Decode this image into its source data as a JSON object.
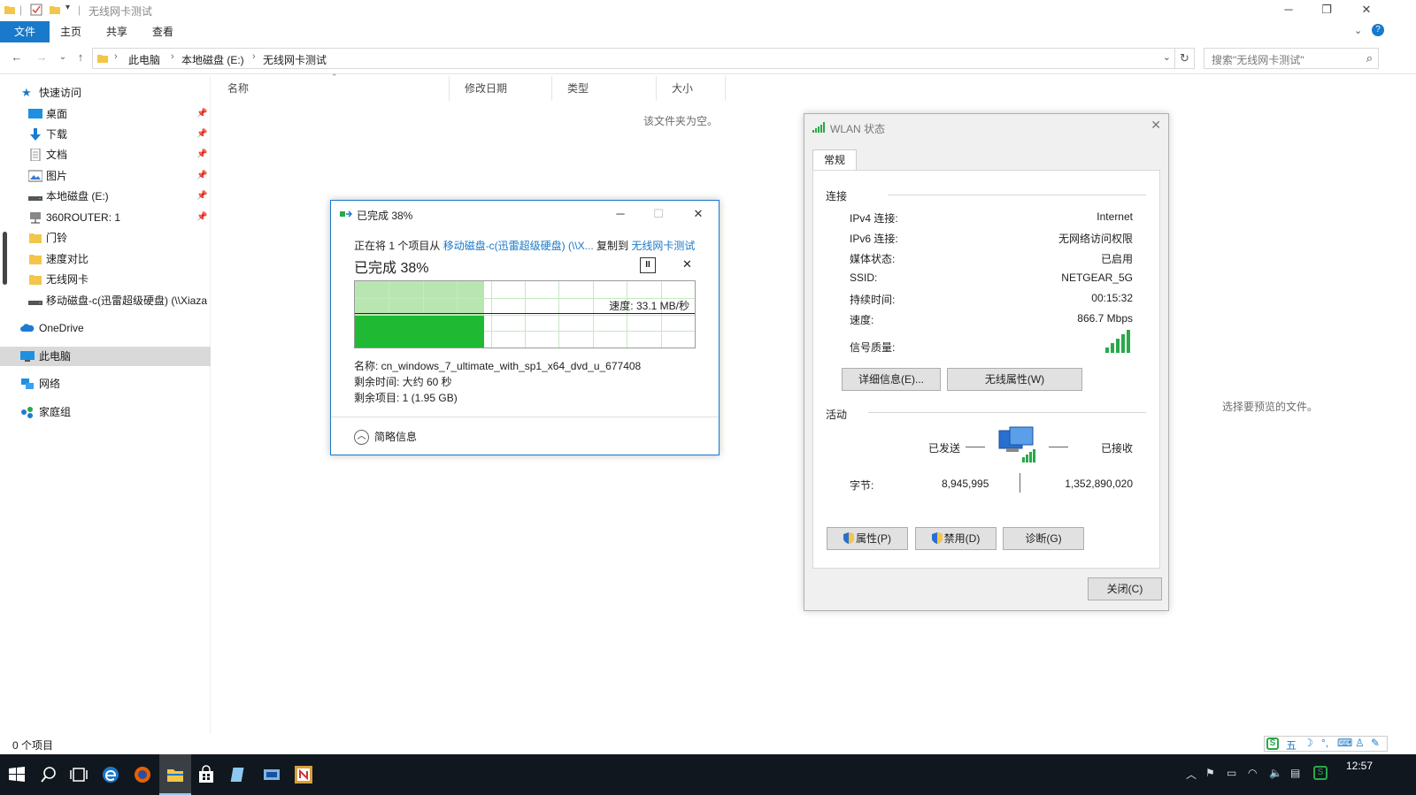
{
  "explorer": {
    "title": "无线网卡测试",
    "ribbon_tabs": [
      "文件",
      "主页",
      "共享",
      "查看"
    ],
    "breadcrumb": [
      "此电脑",
      "本地磁盘 (E:)",
      "无线网卡测试"
    ],
    "search_placeholder": "搜索\"无线网卡测试\"",
    "columns": [
      "名称",
      "修改日期",
      "类型",
      "大小"
    ],
    "empty_message": "该文件夹为空。",
    "preview_message": "选择要预览的文件。",
    "status_count": "0 个项目"
  },
  "nav": {
    "quick_access": "快速访问",
    "items": [
      {
        "label": "桌面",
        "icon": "desktop-icon"
      },
      {
        "label": "下载",
        "icon": "download-icon"
      },
      {
        "label": "文档",
        "icon": "document-icon"
      },
      {
        "label": "图片",
        "icon": "pictures-icon"
      },
      {
        "label": "本地磁盘 (E:)",
        "icon": "drive-icon"
      },
      {
        "label": "360ROUTER: 1",
        "icon": "network-drive-icon"
      },
      {
        "label": "门铃",
        "icon": "folder-icon"
      },
      {
        "label": "速度对比",
        "icon": "folder-icon"
      },
      {
        "label": "无线网卡",
        "icon": "folder-icon"
      },
      {
        "label": "移动磁盘-c(迅雷超级硬盘) (\\\\Xiaza",
        "icon": "network-drive-icon"
      }
    ],
    "onedrive": "OneDrive",
    "this_pc": "此电脑",
    "network": "网络",
    "homegroup": "家庭组"
  },
  "copy_dialog": {
    "title": "已完成 38%",
    "line_prefix": "正在将 1 个项目从 ",
    "source": "移动磁盘-c(迅雷超级硬盘) (\\\\X...",
    "line_mid": " 复制到 ",
    "dest": "无线网卡测试",
    "progress_text": "已完成 38%",
    "progress": 0.38,
    "speed": "速度: 33.1 MB/秒",
    "name_line": "名称: cn_windows_7_ultimate_with_sp1_x64_dvd_u_677408",
    "time_line": "剩余时间: 大约 60 秒",
    "items_line": "剩余项目: 1 (1.95 GB)",
    "more_label": "简略信息"
  },
  "wlan": {
    "title": "WLAN 状态",
    "tab": "常规",
    "connection_header": "连接",
    "rows": [
      {
        "label": "IPv4 连接:",
        "value": "Internet"
      },
      {
        "label": "IPv6 连接:",
        "value": "无网络访问权限"
      },
      {
        "label": "媒体状态:",
        "value": "已启用"
      },
      {
        "label": "SSID:",
        "value": "NETGEAR_5G"
      },
      {
        "label": "持续时间:",
        "value": "00:15:32"
      },
      {
        "label": "速度:",
        "value": "866.7 Mbps"
      }
    ],
    "signal_label": "信号质量:",
    "details_button": "详细信息(E)...",
    "wireless_props_button": "无线属性(W)",
    "activity_header": "活动",
    "sent_label": "已发送",
    "received_label": "已接收",
    "bytes_label": "字节:",
    "bytes_sent": "8,945,995",
    "bytes_received": "1,352,890,020",
    "properties_button": "属性(P)",
    "disable_button": "禁用(D)",
    "diagnose_button": "诊断(G)",
    "close_button": "关闭(C)"
  },
  "taskbar": {
    "clock": "12:57"
  },
  "ime": {
    "mode": "五"
  },
  "colors": {
    "accent": "#1979ca",
    "progress_light": "#b8e6b0",
    "progress_dark": "#1fb934",
    "taskbar": "#10171e"
  }
}
